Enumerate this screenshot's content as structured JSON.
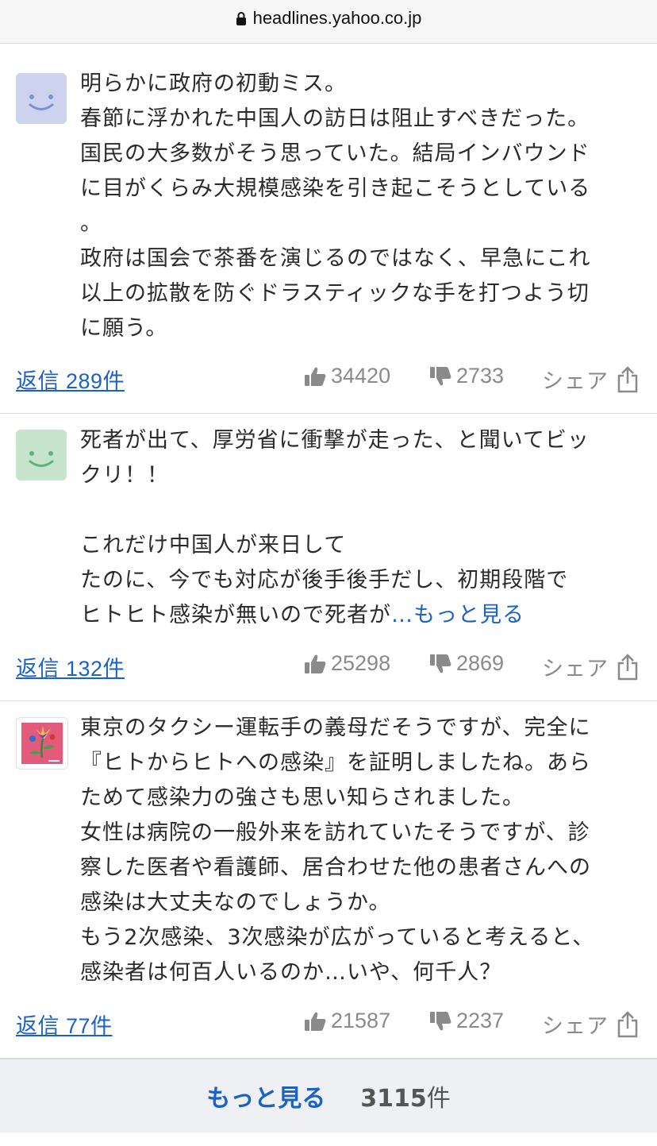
{
  "browser": {
    "url": "headlines.yahoo.co.jp"
  },
  "comments": [
    {
      "lines": [
        "明らかに政府の初動ミス。",
        "春節に浮かれた中国人の訪日は阻止すべきだった。",
        "国民の大多数がそう思っていた。結局インバウンド",
        "に目がくらみ大規模感染を引き起こそうとしている",
        "。",
        "政府は国会で茶番を演じるのではなく、早急にこれ",
        "以上の拡散を防ぐドラスティックな手を打つよう切",
        "に願う。"
      ],
      "reply": "返信 289件",
      "likes": "34420",
      "dislikes": "2733",
      "share": "シェア",
      "avatar_color": "#cdd3ee"
    },
    {
      "lines": [
        "死者が出て、厚労省に衝撃が走った、と聞いてビッ",
        "クリ！！",
        "",
        "これだけ中国人が来日して",
        "たのに、今でも対応が後手後手だし、初期段階で"
      ],
      "last_line": "ヒトヒト感染が無いので死者が",
      "more_link": "…もっと見る",
      "reply": "返信 132件",
      "likes": "25298",
      "dislikes": "2869",
      "share": "シェア",
      "avatar_color": "#c6e4cc"
    },
    {
      "lines": [
        "東京のタクシー運転手の義母だそうですが、完全に",
        "『ヒトからヒトへの感染』を証明しましたね。あら",
        "ためて感染力の強さも思い知らされました。",
        "女性は病院の一般外来を訪れていたそうですが、診",
        "察した医者や看護師、居合わせた他の患者さんへの",
        "感染は大丈夫なのでしょうか。",
        "もう2次感染、3次感染が広がっていると考えると、",
        "感染者は何百人いるのか…いや、何千人？"
      ],
      "reply": "返信 77件",
      "likes": "21587",
      "dislikes": "2237",
      "share": "シェア",
      "avatar_color": "#e35a7a"
    }
  ],
  "footer": {
    "more_label": "もっと見る",
    "count": "3115",
    "count_unit": "件"
  },
  "icons": {
    "like": "thumbs-up-icon",
    "dislike": "thumbs-down-icon",
    "share": "share-icon",
    "lock": "lock-icon"
  }
}
